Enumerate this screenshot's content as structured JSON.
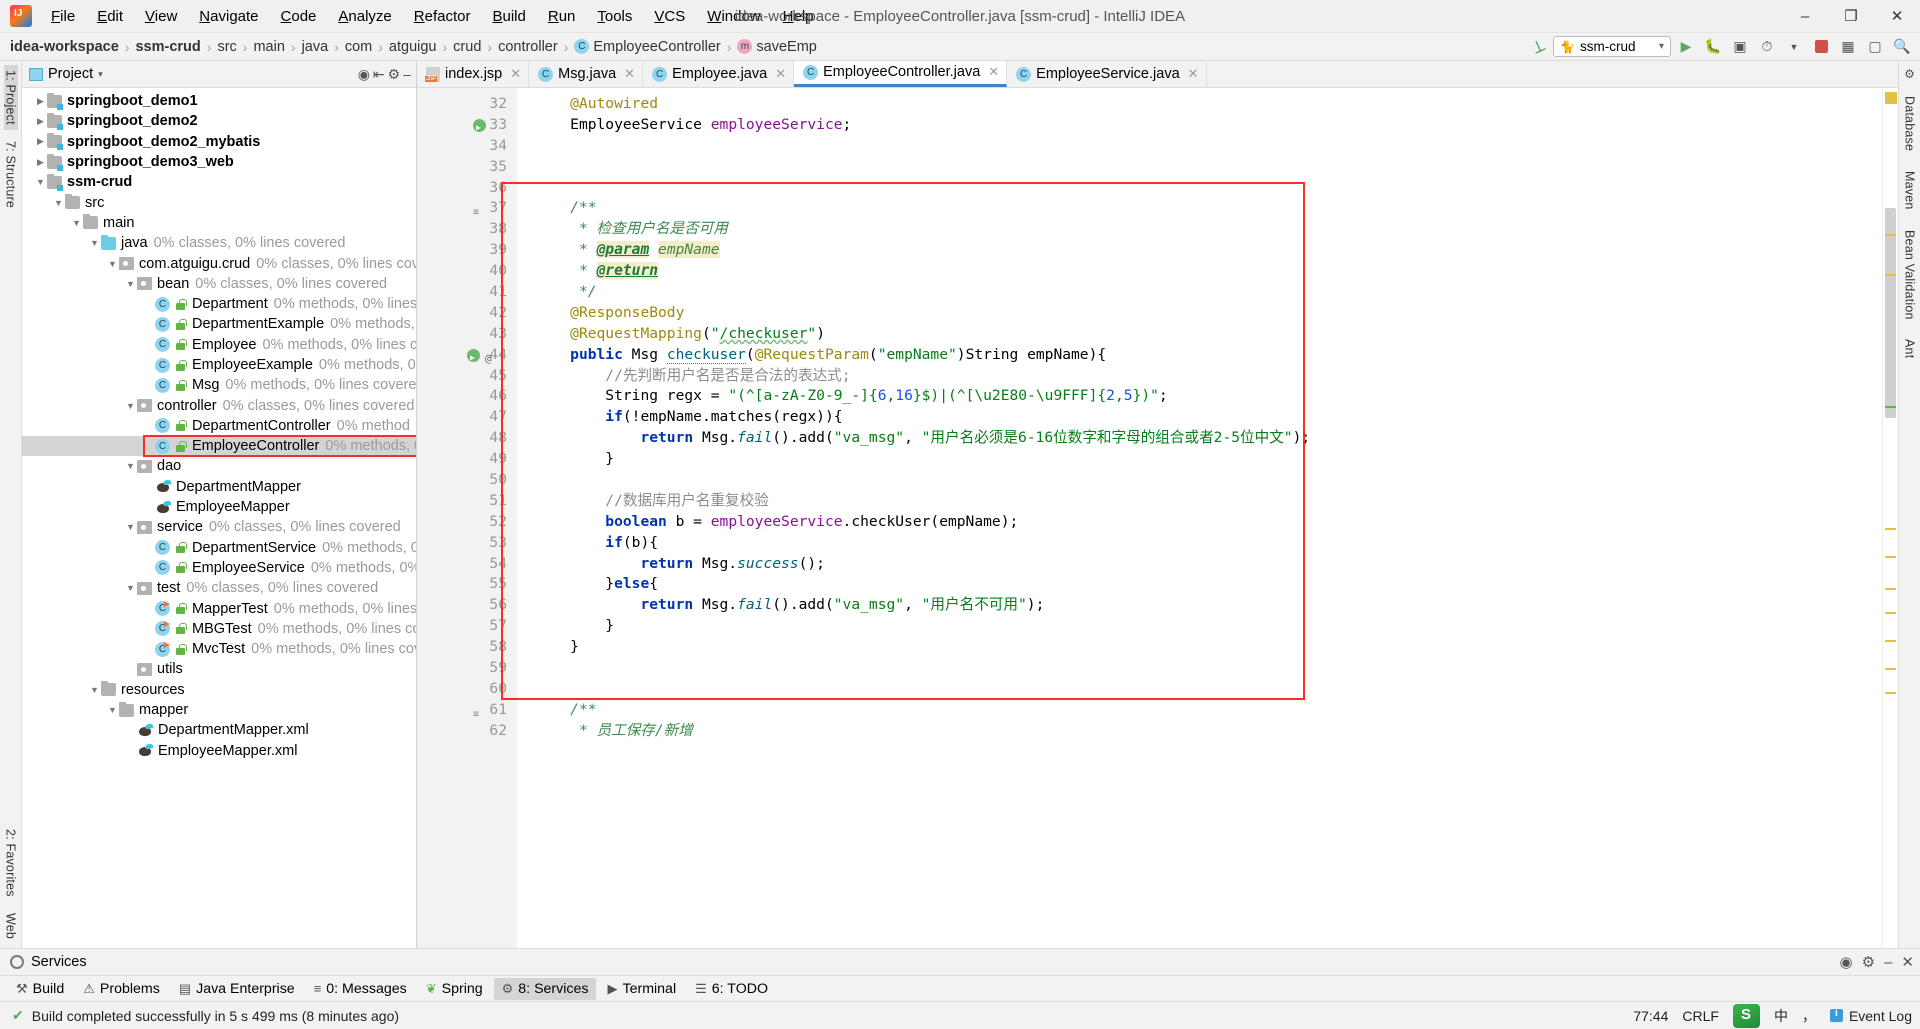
{
  "window": {
    "title": "idea-workspace - EmployeeController.java [ssm-crud] - IntelliJ IDEA",
    "minimize": "–",
    "maximize": "❐",
    "close": "✕"
  },
  "menu": [
    "File",
    "Edit",
    "View",
    "Navigate",
    "Code",
    "Analyze",
    "Refactor",
    "Build",
    "Run",
    "Tools",
    "VCS",
    "Window",
    "Help"
  ],
  "breadcrumb": [
    {
      "label": "idea-workspace",
      "bold": true,
      "icon": ""
    },
    {
      "label": "ssm-crud",
      "bold": true,
      "icon": ""
    },
    {
      "label": "src",
      "bold": false,
      "icon": ""
    },
    {
      "label": "main",
      "bold": false,
      "icon": ""
    },
    {
      "label": "java",
      "bold": false,
      "icon": ""
    },
    {
      "label": "com",
      "bold": false,
      "icon": ""
    },
    {
      "label": "atguigu",
      "bold": false,
      "icon": ""
    },
    {
      "label": "crud",
      "bold": false,
      "icon": ""
    },
    {
      "label": "controller",
      "bold": false,
      "icon": ""
    },
    {
      "label": "EmployeeController",
      "bold": false,
      "icon": "class-icon",
      "iconLetter": "C"
    },
    {
      "label": "saveEmp",
      "bold": false,
      "icon": "method-icon",
      "iconLetter": "m"
    }
  ],
  "toolbar_right": {
    "run_config": "ssm-crud",
    "run_config_icon": "ant-cat-icon",
    "dropdown": "▾",
    "icons": [
      "hammer-icon",
      "run-icon",
      "debug-icon",
      "coverage-icon",
      "profile-icon",
      "attach-icon",
      "stop-icon",
      "layout-icon",
      "device-icon",
      "search-icon"
    ]
  },
  "project_panel": {
    "title": "Project",
    "dropdown": "▾",
    "header_icons": [
      "locate-icon",
      "collapse-all-icon",
      "settings-icon",
      "hide-icon"
    ],
    "tree": [
      {
        "indent": 1,
        "twisty": "closed",
        "icon": "module-folder",
        "label": "springboot_demo1",
        "bold": true,
        "coverage": ""
      },
      {
        "indent": 1,
        "twisty": "closed",
        "icon": "module-folder",
        "label": "springboot_demo2",
        "bold": true,
        "coverage": ""
      },
      {
        "indent": 1,
        "twisty": "closed",
        "icon": "module-folder",
        "label": "springboot_demo2_mybatis",
        "bold": true,
        "coverage": ""
      },
      {
        "indent": 1,
        "twisty": "closed",
        "icon": "module-folder",
        "label": "springboot_demo3_web",
        "bold": true,
        "coverage": ""
      },
      {
        "indent": 1,
        "twisty": "open",
        "icon": "module-folder",
        "label": "ssm-crud",
        "bold": true,
        "coverage": ""
      },
      {
        "indent": 2,
        "twisty": "open",
        "icon": "folder",
        "label": "src",
        "bold": false,
        "coverage": ""
      },
      {
        "indent": 3,
        "twisty": "open",
        "icon": "folder",
        "label": "main",
        "bold": false,
        "coverage": ""
      },
      {
        "indent": 4,
        "twisty": "open",
        "icon": "source-folder",
        "label": "java",
        "bold": false,
        "coverage": "0% classes, 0% lines covered"
      },
      {
        "indent": 5,
        "twisty": "open",
        "icon": "package",
        "label": "com.atguigu.crud",
        "bold": false,
        "coverage": "0% classes, 0% lines covere"
      },
      {
        "indent": 6,
        "twisty": "open",
        "icon": "package",
        "label": "bean",
        "bold": false,
        "coverage": "0% classes, 0% lines covered"
      },
      {
        "indent": 7,
        "twisty": "none",
        "icon": "class",
        "label": "Department",
        "bold": false,
        "coverage": "0% methods, 0% lines"
      },
      {
        "indent": 7,
        "twisty": "none",
        "icon": "class",
        "label": "DepartmentExample",
        "bold": false,
        "coverage": "0% methods,"
      },
      {
        "indent": 7,
        "twisty": "none",
        "icon": "class",
        "label": "Employee",
        "bold": false,
        "coverage": "0% methods, 0% lines co"
      },
      {
        "indent": 7,
        "twisty": "none",
        "icon": "class",
        "label": "EmployeeExample",
        "bold": false,
        "coverage": "0% methods, 0%"
      },
      {
        "indent": 7,
        "twisty": "none",
        "icon": "class",
        "label": "Msg",
        "bold": false,
        "coverage": "0% methods, 0% lines covered"
      },
      {
        "indent": 6,
        "twisty": "open",
        "icon": "package",
        "label": "controller",
        "bold": false,
        "coverage": "0% classes, 0% lines covered"
      },
      {
        "indent": 7,
        "twisty": "none",
        "icon": "class",
        "label": "DepartmentController",
        "bold": false,
        "coverage": "0% method"
      },
      {
        "indent": 7,
        "twisty": "none",
        "icon": "class",
        "label": "EmployeeController",
        "bold": false,
        "coverage": "0% methods, 0",
        "selected": true,
        "highlight": true
      },
      {
        "indent": 6,
        "twisty": "open",
        "icon": "package",
        "label": "dao",
        "bold": false,
        "coverage": ""
      },
      {
        "indent": 7,
        "twisty": "none",
        "icon": "mapper",
        "label": "DepartmentMapper",
        "bold": false,
        "coverage": ""
      },
      {
        "indent": 7,
        "twisty": "none",
        "icon": "mapper",
        "label": "EmployeeMapper",
        "bold": false,
        "coverage": ""
      },
      {
        "indent": 6,
        "twisty": "open",
        "icon": "package",
        "label": "service",
        "bold": false,
        "coverage": "0% classes, 0% lines covered"
      },
      {
        "indent": 7,
        "twisty": "none",
        "icon": "class",
        "label": "DepartmentService",
        "bold": false,
        "coverage": "0% methods, 0"
      },
      {
        "indent": 7,
        "twisty": "none",
        "icon": "class",
        "label": "EmployeeService",
        "bold": false,
        "coverage": "0% methods, 0%"
      },
      {
        "indent": 6,
        "twisty": "open",
        "icon": "package",
        "label": "test",
        "bold": false,
        "coverage": "0% classes, 0% lines covered"
      },
      {
        "indent": 7,
        "twisty": "none",
        "icon": "test-class",
        "label": "MapperTest",
        "bold": false,
        "coverage": "0% methods, 0% lines"
      },
      {
        "indent": 7,
        "twisty": "none",
        "icon": "test-class",
        "label": "MBGTest",
        "bold": false,
        "coverage": "0% methods, 0% lines cov"
      },
      {
        "indent": 7,
        "twisty": "none",
        "icon": "test-class",
        "label": "MvcTest",
        "bold": false,
        "coverage": "0% methods, 0% lines cov"
      },
      {
        "indent": 6,
        "twisty": "none",
        "icon": "package",
        "label": "utils",
        "bold": false,
        "coverage": ""
      },
      {
        "indent": 4,
        "twisty": "open",
        "icon": "folder",
        "label": "resources",
        "bold": false,
        "coverage": ""
      },
      {
        "indent": 5,
        "twisty": "open",
        "icon": "folder",
        "label": "mapper",
        "bold": false,
        "coverage": ""
      },
      {
        "indent": 6,
        "twisty": "none",
        "icon": "xml",
        "label": "DepartmentMapper.xml",
        "bold": false,
        "coverage": ""
      },
      {
        "indent": 6,
        "twisty": "none",
        "icon": "xml",
        "label": "EmployeeMapper.xml",
        "bold": false,
        "coverage": ""
      }
    ]
  },
  "left_rail": {
    "top": [
      "1: Project"
    ],
    "bottom": [
      "2: Favorites",
      "Web"
    ],
    "structure": "7: Structure"
  },
  "right_rail": [
    "Database",
    "Maven",
    "Bean Validation",
    "Ant"
  ],
  "editor_tabs": [
    {
      "label": "index.jsp",
      "icon": "jsp-icon",
      "active": false
    },
    {
      "label": "Msg.java",
      "icon": "class-icon",
      "active": false
    },
    {
      "label": "Employee.java",
      "icon": "class-icon",
      "active": false
    },
    {
      "label": "EmployeeController.java",
      "icon": "class-icon",
      "active": true
    },
    {
      "label": "EmployeeService.java",
      "icon": "class-icon",
      "active": false
    }
  ],
  "code": {
    "first_line": 32,
    "lines": [
      {
        "n": 32,
        "html": "    <span class='ann'>@Autowired</span>"
      },
      {
        "n": 33,
        "html": "    <span class='plain'>EmployeeService </span><span class='fld'>employeeService</span><span class='plain'>;</span>",
        "gutterIcon": "bean-icon"
      },
      {
        "n": 34,
        "html": ""
      },
      {
        "n": 35,
        "html": ""
      },
      {
        "n": 36,
        "html": ""
      },
      {
        "n": 37,
        "html": "    <span class='doc'>/**</span>",
        "fold": "start",
        "indentIcon": true
      },
      {
        "n": 38,
        "html": "     <span class='doc'>* 检查用户名是否可用</span>"
      },
      {
        "n": 39,
        "html": "     <span class='doc'>* </span><span class='doctag'>@param</span><span class='doc'> </span><span class='docparam'>empName</span>"
      },
      {
        "n": 40,
        "html": "     <span class='doc'>* </span><span class='doctag'>@return</span>"
      },
      {
        "n": 41,
        "html": "     <span class='doc'>*/</span>",
        "fold": "end"
      },
      {
        "n": 42,
        "html": "    <span class='ann'>@ResponseBody</span>",
        "fold": "start"
      },
      {
        "n": 43,
        "html": "    <span class='ann'>@RequestMapping</span><span class='plain'>(</span><span class='str'>\"</span><span class='str wavy'>/checkuser</span><span class='str'>\"</span><span class='plain'>)</span>",
        "fold": "end"
      },
      {
        "n": 44,
        "html": "    <span class='kw'>public</span><span class='plain'> Msg </span><span class='mth sq-und'>checkuser</span><span class='plain'>(</span><span class='ann'>@RequestParam</span><span class='plain'>(</span><span class='str'>\"empName\"</span><span class='plain'>)String empName){</span>",
        "gutterIcon": "run-at-icon",
        "fold": "start"
      },
      {
        "n": 45,
        "html": "        <span class='cmt'>//先判断用户名是否是合法的表达式;</span>"
      },
      {
        "n": 46,
        "html": "        <span class='plain'>String regx = </span><span class='str'>\"(^[a-zA-Z0-9_-]{</span><span class='num'>6</span><span class='str'>,</span><span class='num'>16</span><span class='str'>}$)|(^[\\u2E80-\\u9FFF]{</span><span class='num'>2</span><span class='str'>,</span><span class='num'>5</span><span class='str'>})\"</span><span class='plain'>;</span>"
      },
      {
        "n": 47,
        "html": "        <span class='kw'>if</span><span class='plain'>(!empName.matches(regx)){</span>",
        "fold": "start"
      },
      {
        "n": 48,
        "html": "            <span class='kw'>return</span><span class='plain'> Msg.</span><span class='mth' style='font-style:italic'>fail</span><span class='plain'>().add(</span><span class='str'>\"va_msg\"</span><span class='plain'>, </span><span class='str'>\"用户名必须是6-16位数字和字母的组合或者2-5位中文\"</span><span class='plain'>);</span>"
      },
      {
        "n": 49,
        "html": "        <span class='plain'>}</span>",
        "fold": "end"
      },
      {
        "n": 50,
        "html": ""
      },
      {
        "n": 51,
        "html": "        <span class='cmt'>//数据库用户名重复校验</span>"
      },
      {
        "n": 52,
        "html": "        <span class='kw'>boolean</span><span class='plain'> b = </span><span class='fld'>employeeService</span><span class='plain'>.checkUser(empName);</span>"
      },
      {
        "n": 53,
        "html": "        <span class='kw'>if</span><span class='plain'>(b){</span>",
        "fold": "start"
      },
      {
        "n": 54,
        "html": "            <span class='kw'>return</span><span class='plain'> Msg.</span><span class='mth' style='font-style:italic'>success</span><span class='plain'>();</span>"
      },
      {
        "n": 55,
        "html": "        <span class='plain'>}</span><span class='kw'>else</span><span class='plain'>{</span>",
        "fold": "end"
      },
      {
        "n": 56,
        "html": "            <span class='kw'>return</span><span class='plain'> Msg.</span><span class='mth' style='font-style:italic'>fail</span><span class='plain'>().add(</span><span class='str'>\"va_msg\"</span><span class='plain'>, </span><span class='str'>\"用户名不可用\"</span><span class='plain'>);</span>"
      },
      {
        "n": 57,
        "html": "        <span class='plain'>}</span>",
        "fold": "end"
      },
      {
        "n": 58,
        "html": "    <span class='plain'>}</span>",
        "fold": "end"
      },
      {
        "n": 59,
        "html": ""
      },
      {
        "n": 60,
        "html": ""
      },
      {
        "n": 61,
        "html": "    <span class='doc'>/**</span>",
        "fold": "start",
        "indentIcon": true
      },
      {
        "n": 62,
        "html": "     <span class='doc'>* 员工保存/新增</span>"
      }
    ]
  },
  "services": {
    "label": "Services",
    "right_icons": [
      "settings-gear-icon",
      "minimize-icon",
      "close-icon",
      "help-icon"
    ]
  },
  "tool_windows": [
    {
      "label": "Build",
      "icon": "build-icon",
      "active": false
    },
    {
      "label": "Problems",
      "icon": "warning-icon",
      "active": false
    },
    {
      "label": "Java Enterprise",
      "icon": "java-ee-icon",
      "active": false
    },
    {
      "label": "0: Messages",
      "icon": "messages-icon",
      "active": false
    },
    {
      "label": "Spring",
      "icon": "spring-icon",
      "active": false
    },
    {
      "label": "8: Services",
      "icon": "services-icon",
      "active": true
    },
    {
      "label": "Terminal",
      "icon": "terminal-icon",
      "active": false
    },
    {
      "label": "6: TODO",
      "icon": "todo-icon",
      "active": false
    }
  ],
  "status_bar": {
    "message": "Build completed successfully in 5 s 499 ms (8 minutes ago)",
    "caret": "77:44",
    "line_sep": "CRLF",
    "event_log": "Event Log",
    "ime_lang": "中",
    "ime_punct": "，"
  }
}
